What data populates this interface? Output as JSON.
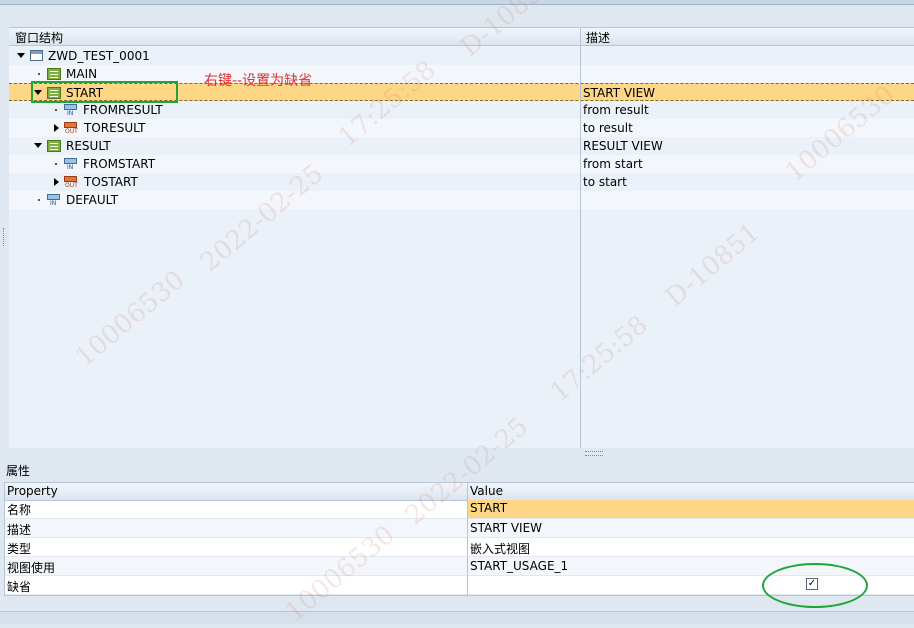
{
  "tree": {
    "header_structure": "窗口结构",
    "header_description": "描述",
    "rows": [
      {
        "label": "ZWD_TEST_0001",
        "desc": ""
      },
      {
        "label": "MAIN",
        "desc": ""
      },
      {
        "label": "START",
        "desc": "START VIEW"
      },
      {
        "label": "FROMRESULT",
        "desc": "from result"
      },
      {
        "label": "TORESULT",
        "desc": "to result"
      },
      {
        "label": "RESULT",
        "desc": "RESULT VIEW"
      },
      {
        "label": "FROMSTART",
        "desc": "from start"
      },
      {
        "label": "TOSTART",
        "desc": "to start"
      },
      {
        "label": "DEFAULT",
        "desc": ""
      }
    ],
    "icon_labels": {
      "in": "IN",
      "out": "OUT"
    }
  },
  "annotation": "右键--设置为缺省",
  "properties": {
    "title": "属性",
    "col_property": "Property",
    "col_value": "Value",
    "rows": [
      {
        "prop": "名称",
        "value": "START"
      },
      {
        "prop": "描述",
        "value": "START VIEW"
      },
      {
        "prop": "类型",
        "value": "嵌入式视图"
      },
      {
        "prop": "视图使用",
        "value": "START_USAGE_1"
      },
      {
        "prop": "缺省",
        "value": ""
      }
    ],
    "default_checked": "✓"
  },
  "watermarks": [
    "D-10851",
    "17:25:58",
    "2022-02-25",
    "10006530"
  ],
  "colors": {
    "selection": "#fdd686",
    "annotation": "#e03030",
    "highlight": "#22a33a"
  }
}
